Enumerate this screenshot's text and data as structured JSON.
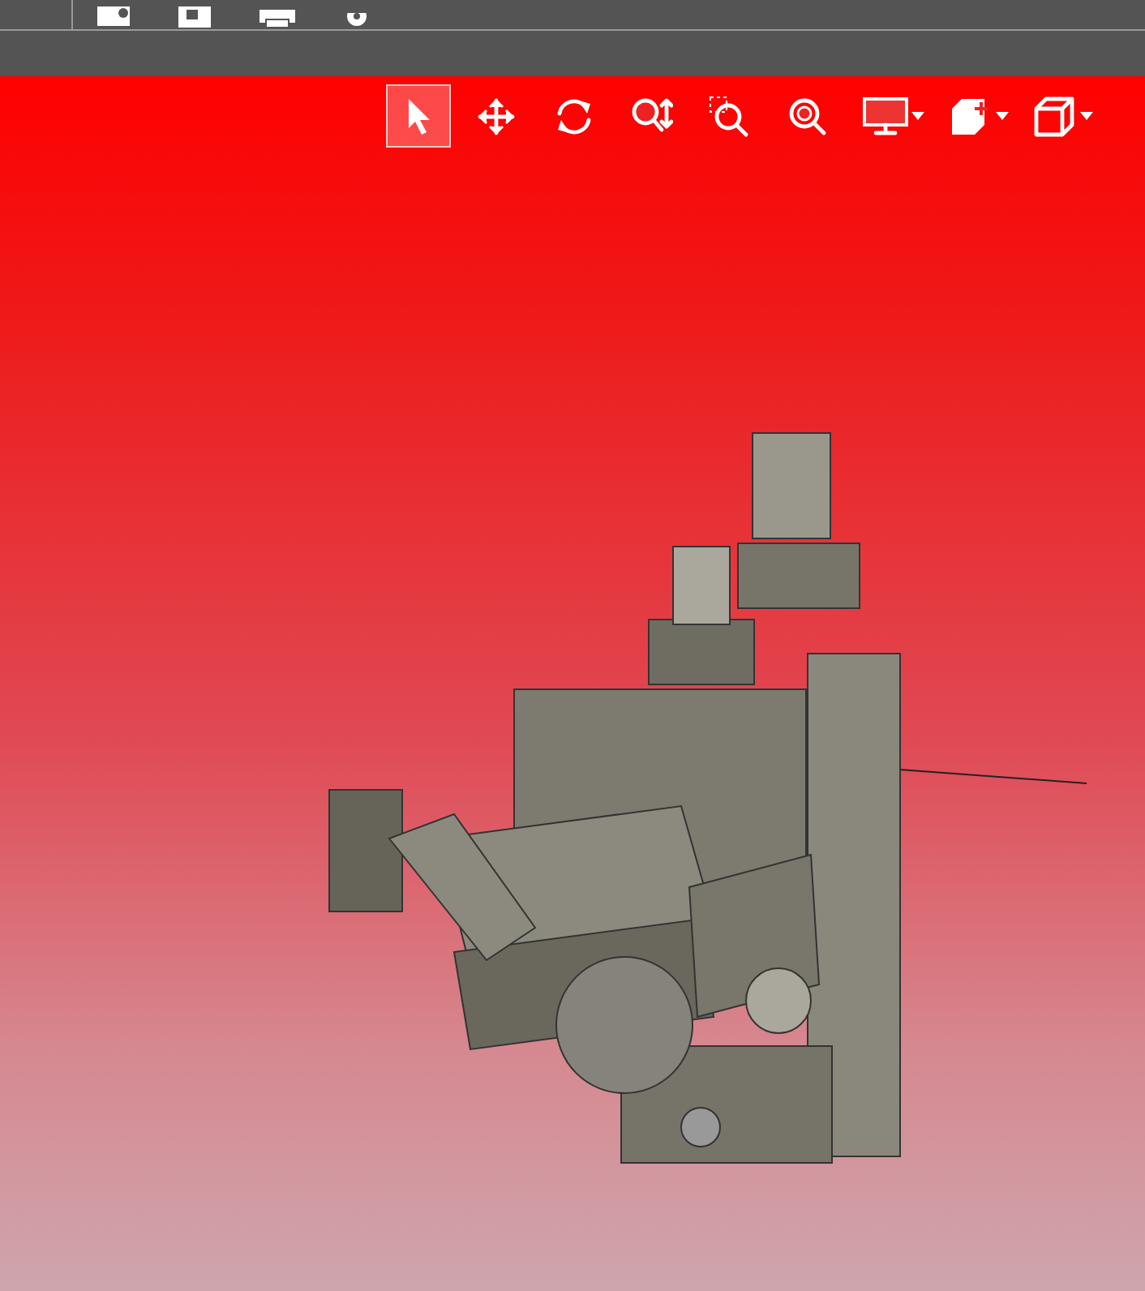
{
  "menu_toolbar": {
    "icons": [
      {
        "kind": "folder"
      },
      {
        "kind": "save"
      },
      {
        "kind": "print"
      },
      {
        "kind": "gear"
      }
    ]
  },
  "view_toolbar": {
    "tools": [
      {
        "kind": "select",
        "selected": true,
        "dropdown": false
      },
      {
        "kind": "pan",
        "selected": false,
        "dropdown": false
      },
      {
        "kind": "rotate",
        "selected": false,
        "dropdown": false
      },
      {
        "kind": "zoom",
        "selected": false,
        "dropdown": false
      },
      {
        "kind": "zoom_box",
        "selected": false,
        "dropdown": false
      },
      {
        "kind": "zoom_fit",
        "selected": false,
        "dropdown": false
      },
      {
        "kind": "display",
        "selected": false,
        "dropdown": true
      },
      {
        "kind": "section",
        "selected": false,
        "dropdown": true
      },
      {
        "kind": "view_cube",
        "selected": false,
        "dropdown": true
      }
    ]
  }
}
